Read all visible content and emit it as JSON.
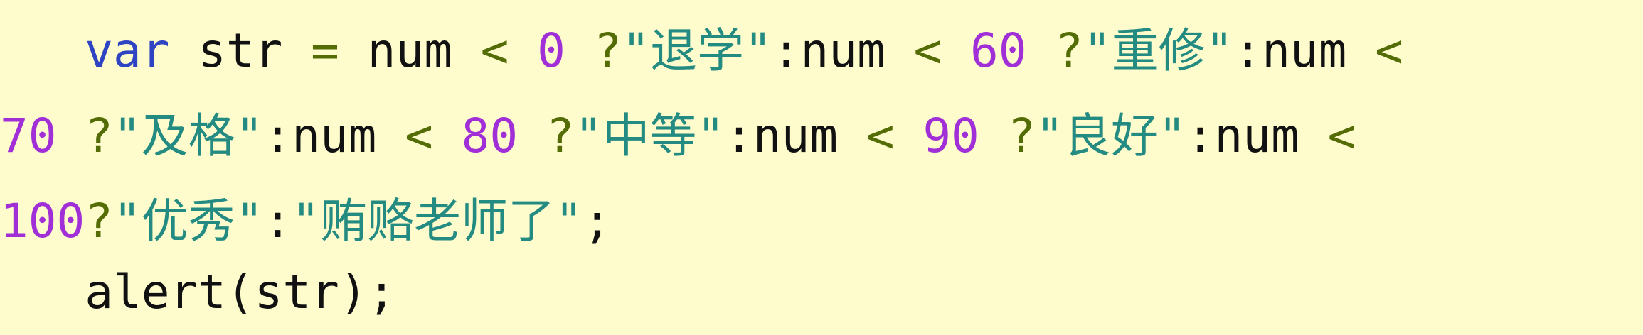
{
  "editor": {
    "lines": [
      {
        "indent": "   ",
        "tokens": [
          {
            "type": "keyword",
            "text": "var"
          },
          {
            "type": "plain",
            "text": " str "
          },
          {
            "type": "op",
            "text": "="
          },
          {
            "type": "plain",
            "text": " num "
          },
          {
            "type": "op",
            "text": "<"
          },
          {
            "type": "plain",
            "text": " "
          },
          {
            "type": "number",
            "text": "0"
          },
          {
            "type": "plain",
            "text": " "
          },
          {
            "type": "op",
            "text": "?"
          },
          {
            "type": "string",
            "text": "\"退学\""
          },
          {
            "type": "plain",
            "text": ":num "
          },
          {
            "type": "op",
            "text": "<"
          },
          {
            "type": "plain",
            "text": " "
          },
          {
            "type": "number",
            "text": "60"
          },
          {
            "type": "plain",
            "text": " "
          },
          {
            "type": "op",
            "text": "?"
          },
          {
            "type": "string",
            "text": "\"重修\""
          },
          {
            "type": "plain",
            "text": ":num "
          },
          {
            "type": "op",
            "text": "<"
          }
        ]
      },
      {
        "indent": "",
        "tokens": [
          {
            "type": "number",
            "text": "70"
          },
          {
            "type": "plain",
            "text": " "
          },
          {
            "type": "op",
            "text": "?"
          },
          {
            "type": "string",
            "text": "\"及格\""
          },
          {
            "type": "plain",
            "text": ":num "
          },
          {
            "type": "op",
            "text": "<"
          },
          {
            "type": "plain",
            "text": " "
          },
          {
            "type": "number",
            "text": "80"
          },
          {
            "type": "plain",
            "text": " "
          },
          {
            "type": "op",
            "text": "?"
          },
          {
            "type": "string",
            "text": "\"中等\""
          },
          {
            "type": "plain",
            "text": ":num "
          },
          {
            "type": "op",
            "text": "<"
          },
          {
            "type": "plain",
            "text": " "
          },
          {
            "type": "number",
            "text": "90"
          },
          {
            "type": "plain",
            "text": " "
          },
          {
            "type": "op",
            "text": "?"
          },
          {
            "type": "string",
            "text": "\"良好\""
          },
          {
            "type": "plain",
            "text": ":num "
          },
          {
            "type": "op",
            "text": "<"
          }
        ]
      },
      {
        "indent": "",
        "tokens": [
          {
            "type": "number",
            "text": "100"
          },
          {
            "type": "op",
            "text": "?"
          },
          {
            "type": "string",
            "text": "\"优秀\""
          },
          {
            "type": "plain",
            "text": ":"
          },
          {
            "type": "string",
            "text": "\"贿赂老师了\""
          },
          {
            "type": "plain",
            "text": ";"
          }
        ]
      },
      {
        "indent": "   ",
        "tokens": [
          {
            "type": "plain",
            "text": "alert(str);"
          }
        ]
      }
    ]
  },
  "colors": {
    "background": "#fefccc",
    "keyword": "#2f44c2",
    "number": "#a12fd8",
    "operator": "#546c05",
    "string": "#248b82",
    "plain": "#111111"
  }
}
